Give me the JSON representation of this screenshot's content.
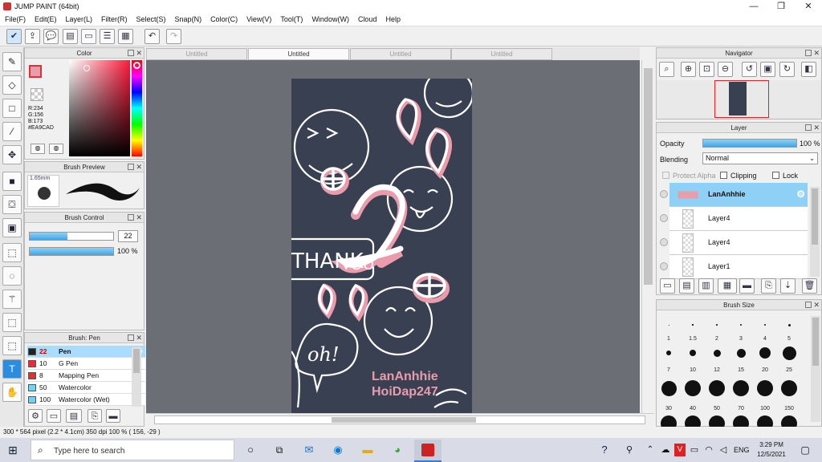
{
  "app": {
    "title": "JUMP PAINT (64bit)"
  },
  "menu": [
    "File(F)",
    "Edit(E)",
    "Layer(L)",
    "Filter(R)",
    "Select(S)",
    "Snap(N)",
    "Color(C)",
    "View(V)",
    "Tool(T)",
    "Window(W)",
    "Cloud",
    "Help"
  ],
  "tabs": [
    "Untitled",
    "Untitled",
    "Untitled",
    "Untitled"
  ],
  "color_panel": {
    "title": "Color",
    "r": "R:234",
    "g": "G:156",
    "b": "B:173",
    "hex": "#EA9CAD",
    "current": "#EA9CAD"
  },
  "brush_preview": {
    "title": "Brush Preview",
    "size": "1.65mm"
  },
  "brush_control": {
    "title": "Brush Control",
    "size": "22",
    "opacity": "100 %",
    "size_fill": 0.45,
    "opacity_fill": 1.0
  },
  "brush_list": {
    "title": "Brush: Pen",
    "items": [
      {
        "n": "22",
        "label": "Pen",
        "color": "#222222",
        "active": true
      },
      {
        "n": "10",
        "label": "G Pen",
        "color": "#e23030",
        "active": false
      },
      {
        "n": "8",
        "label": "Mapping Pen",
        "color": "#e23030",
        "active": false
      },
      {
        "n": "50",
        "label": "Watercolor",
        "color": "#6fd3f5",
        "active": false
      },
      {
        "n": "100",
        "label": "Watercolor (Wet)",
        "color": "#6fd3f5",
        "active": false
      }
    ]
  },
  "navigator": {
    "title": "Navigator"
  },
  "layer_panel": {
    "title": "Layer",
    "opacity_label": "Opacity",
    "opacity_value": "100 %",
    "blending_label": "Blending",
    "blending_value": "Normal",
    "protect_alpha": "Protect Alpha",
    "clipping": "Clipping",
    "lock": "Lock",
    "layers": [
      {
        "name": "LanAnhhie",
        "selected": true
      },
      {
        "name": "Layer4",
        "selected": false
      },
      {
        "name": "Layer4",
        "selected": false
      },
      {
        "name": "Layer1",
        "selected": false
      }
    ]
  },
  "brush_size": {
    "title": "Brush Size",
    "labels": [
      "1",
      "1.5",
      "2",
      "3",
      "4",
      "5",
      "7",
      "10",
      "12",
      "15",
      "20",
      "25",
      "30",
      "40",
      "50",
      "70",
      "100",
      "150"
    ]
  },
  "artwork": {
    "thank": "THANK",
    "you": "YOU",
    "two": "2",
    "oh": "oh!",
    "sig1": "LanAnhhie",
    "sig2": "HoiDap247"
  },
  "status": {
    "text": "300 * 564 pixel   (2.2 * 4.1cm)   350 dpi   100 %   ( 156, -29 )"
  },
  "taskbar": {
    "search_placeholder": "Type here to search",
    "lang": "ENG",
    "time": "3:29 PM",
    "date": "12/5/2021"
  }
}
